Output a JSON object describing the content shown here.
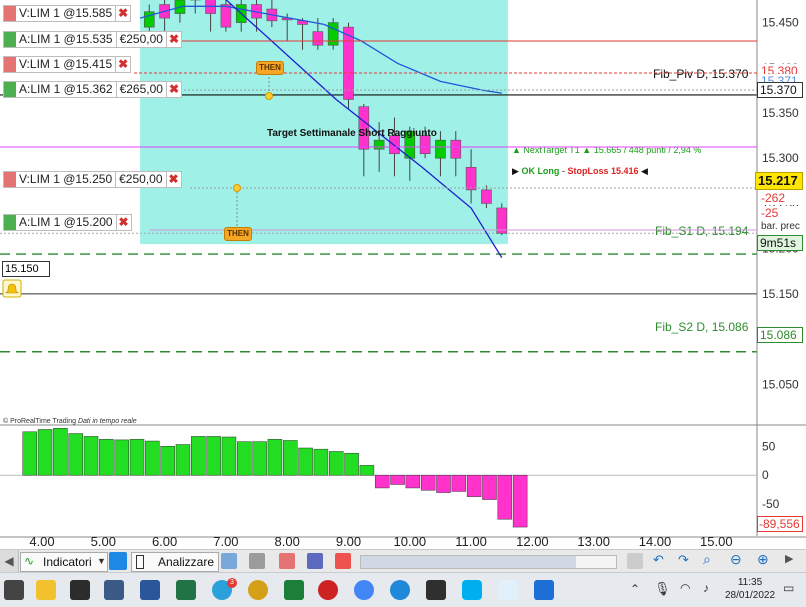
{
  "colors": {
    "bull": "#00cc00",
    "bear": "#ff33cc",
    "zone": "#9ff0e6",
    "fib": "#2e8b2e",
    "ma_fast": "#1f1fd0",
    "ma_slow": "#2255dd",
    "osc_pos": "#22dd22",
    "osc_neg": "#ff33cc"
  },
  "header": {
    "note": "Target Settimanale Short Raggiunto",
    "next_target_prefix": "▲ NextTarget T1 ▲",
    "next_target_value": "15.665",
    "next_target_points": "448 punti",
    "next_target_pct": "2,94 %",
    "ok_long": "OK Long",
    "stoploss": "StopLoss 15.416"
  },
  "orders": [
    {
      "side": "sell",
      "label": "V:LIM 1 @15.585",
      "amount": "",
      "price": 15.585
    },
    {
      "side": "buy",
      "label": "A:LIM 1 @15.535",
      "amount": "€250,00",
      "price": 15.535
    },
    {
      "side": "sell",
      "label": "V:LIM 1 @15.415",
      "amount": "",
      "price": 15.415
    },
    {
      "side": "buy",
      "label": "A:LIM 1 @15.362",
      "amount": "€265,00",
      "price": 15.362
    },
    {
      "side": "sell",
      "label": "V:LIM 1 @15.250",
      "amount": "€250,00",
      "price": 15.25
    },
    {
      "side": "buy",
      "label": "A:LIM 1 @15.200",
      "amount": "",
      "price": 15.2
    }
  ],
  "then_label": "THEN",
  "price_labels": {
    "p15380": "15.380",
    "p15371": "15.371",
    "p15370": "15.370",
    "last": "15.217",
    "chg1": "-262",
    "chg2": "-25",
    "barprec": "bar. prec",
    "timer": "9m51s",
    "p15086": "15.086",
    "p15150": "15.150"
  },
  "fib_labels": {
    "piv": "Fib_Piv D, 15.370",
    "s1": "Fib_S1 D, 15.194",
    "s2": "Fib_S2 D, 15.086"
  },
  "osc_labels": {
    "copyright": "© ProRealTime Trading",
    "realtime": "Dati in tempo reale",
    "last": "-89,556"
  },
  "chart_data": {
    "type": "candlestick",
    "ylim": [
      15.005,
      15.475
    ],
    "y_ticks": [
      15.45,
      15.4,
      15.35,
      15.3,
      15.25,
      15.2,
      15.15,
      15.1,
      15.05
    ],
    "y_tick_labels": [
      "15.450",
      "15.400",
      "15.350",
      "15.300",
      "15.250",
      "15.200",
      "15.150",
      "15.100",
      "15.050"
    ],
    "x_ticks": [
      "4.00",
      "5.00",
      "6.00",
      "7.00",
      "8.00",
      "9.00",
      "10.00",
      "11.00",
      "12.00",
      "13.00",
      "14.00",
      "15.00"
    ],
    "candles": [
      {
        "t": 5.75,
        "o": 15.445,
        "h": 15.47,
        "l": 15.425,
        "c": 15.462
      },
      {
        "t": 6.0,
        "o": 15.47,
        "h": 15.49,
        "l": 15.44,
        "c": 15.455
      },
      {
        "t": 6.25,
        "o": 15.46,
        "h": 15.49,
        "l": 15.45,
        "c": 15.475
      },
      {
        "t": 6.5,
        "o": 15.475,
        "h": 15.49,
        "l": 15.46,
        "c": 15.485
      },
      {
        "t": 6.75,
        "o": 15.48,
        "h": 15.49,
        "l": 15.44,
        "c": 15.46
      },
      {
        "t": 7.0,
        "o": 15.47,
        "h": 15.48,
        "l": 15.44,
        "c": 15.445
      },
      {
        "t": 7.25,
        "o": 15.45,
        "h": 15.475,
        "l": 15.44,
        "c": 15.47
      },
      {
        "t": 7.5,
        "o": 15.47,
        "h": 15.48,
        "l": 15.44,
        "c": 15.455
      },
      {
        "t": 7.75,
        "o": 15.465,
        "h": 15.475,
        "l": 15.445,
        "c": 15.452
      },
      {
        "t": 8.0,
        "o": 15.455,
        "h": 15.46,
        "l": 15.43,
        "c": 15.453
      },
      {
        "t": 8.25,
        "o": 15.452,
        "h": 15.455,
        "l": 15.42,
        "c": 15.448
      },
      {
        "t": 8.5,
        "o": 15.44,
        "h": 15.455,
        "l": 15.42,
        "c": 15.425
      },
      {
        "t": 8.75,
        "o": 15.425,
        "h": 15.455,
        "l": 15.42,
        "c": 15.45
      },
      {
        "t": 9.0,
        "o": 15.445,
        "h": 15.45,
        "l": 15.355,
        "c": 15.365
      },
      {
        "t": 9.25,
        "o": 15.357,
        "h": 15.36,
        "l": 15.28,
        "c": 15.31
      },
      {
        "t": 9.5,
        "o": 15.31,
        "h": 15.34,
        "l": 15.285,
        "c": 15.32
      },
      {
        "t": 9.75,
        "o": 15.325,
        "h": 15.345,
        "l": 15.28,
        "c": 15.305
      },
      {
        "t": 10.0,
        "o": 15.3,
        "h": 15.335,
        "l": 15.275,
        "c": 15.33
      },
      {
        "t": 10.25,
        "o": 15.325,
        "h": 15.335,
        "l": 15.3,
        "c": 15.305
      },
      {
        "t": 10.5,
        "o": 15.3,
        "h": 15.33,
        "l": 15.28,
        "c": 15.32
      },
      {
        "t": 10.75,
        "o": 15.32,
        "h": 15.33,
        "l": 15.28,
        "c": 15.3
      },
      {
        "t": 11.0,
        "o": 15.29,
        "h": 15.31,
        "l": 15.25,
        "c": 15.265
      },
      {
        "t": 11.25,
        "o": 15.265,
        "h": 15.27,
        "l": 15.245,
        "c": 15.25
      },
      {
        "t": 11.5,
        "o": 15.245,
        "h": 15.25,
        "l": 15.215,
        "c": 15.217
      }
    ],
    "fib_levels": [
      {
        "name": "Fib_Piv D",
        "value": 15.37
      },
      {
        "name": "Fib_S1 D",
        "value": 15.194
      },
      {
        "name": "Fib_S2 D",
        "value": 15.086
      }
    ],
    "oscillator": {
      "ylim": [
        -105,
        85
      ],
      "y_ticks": [
        50,
        0,
        -50
      ],
      "y_tick_labels": [
        "50",
        "0",
        "-50"
      ],
      "t": [
        3.8,
        4.05,
        4.3,
        4.55,
        4.8,
        5.05,
        5.3,
        5.55,
        5.8,
        6.05,
        6.3,
        6.55,
        6.8,
        7.05,
        7.3,
        7.55,
        7.8,
        8.05,
        8.3,
        8.55,
        8.8,
        9.05,
        9.3,
        9.55,
        9.8,
        10.05,
        10.3,
        10.55,
        10.8,
        11.05,
        11.3,
        11.55
      ],
      "values": [
        75,
        79,
        81,
        72,
        67,
        62,
        61,
        62,
        59,
        50,
        53,
        67,
        67,
        66,
        58,
        58,
        62,
        60,
        47,
        45,
        41,
        38,
        17,
        -22,
        -16,
        -22,
        -26,
        -30,
        -28,
        -37,
        -42,
        -76,
        -89.556
      ]
    }
  }
}
